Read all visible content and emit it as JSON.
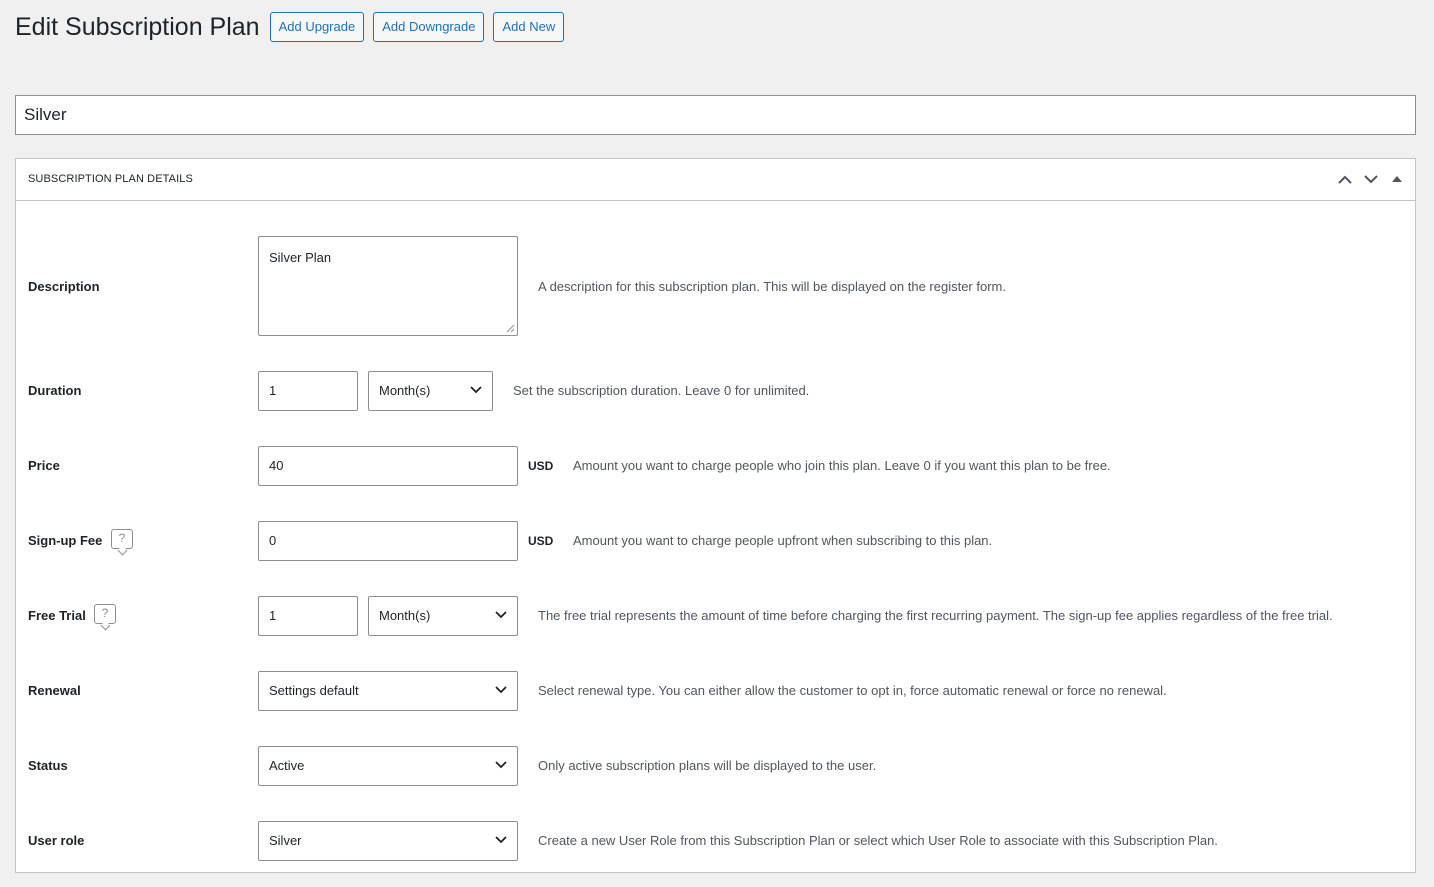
{
  "header": {
    "title": "Edit Subscription Plan",
    "buttons": [
      "Add Upgrade",
      "Add Downgrade",
      "Add New"
    ]
  },
  "plan_title": "Silver",
  "panel": {
    "title": "SUBSCRIPTION PLAN DETAILS",
    "controls": [
      "chevron-up-icon",
      "chevron-down-icon",
      "triangle-up-icon"
    ]
  },
  "fields": {
    "description": {
      "label": "Description",
      "value": "Silver Plan",
      "help": "A description for this subscription plan. This will be displayed on the register form."
    },
    "duration": {
      "label": "Duration",
      "value": "1",
      "unit": "Month(s)",
      "help": "Set the subscription duration. Leave 0 for unlimited."
    },
    "price": {
      "label": "Price",
      "value": "40",
      "currency": "USD",
      "help": "Amount you want to charge people who join this plan. Leave 0 if you want this plan to be free."
    },
    "signup_fee": {
      "label": "Sign-up Fee",
      "tooltip_icon": "?",
      "value": "0",
      "currency": "USD",
      "help": "Amount you want to charge people upfront when subscribing to this plan."
    },
    "free_trial": {
      "label": "Free Trial",
      "tooltip_icon": "?",
      "value": "1",
      "unit": "Month(s)",
      "help": "The free trial represents the amount of time before charging the first recurring payment. The sign-up fee applies regardless of the free trial."
    },
    "renewal": {
      "label": "Renewal",
      "value": "Settings default",
      "help": "Select renewal type. You can either allow the customer to opt in, force automatic renewal or force no renewal."
    },
    "status": {
      "label": "Status",
      "value": "Active",
      "help": "Only active subscription plans will be displayed to the user."
    },
    "user_role": {
      "label": "User role",
      "value": "Silver",
      "help": "Create a new User Role from this Subscription Plan or select which User Role to associate with this Subscription Plan."
    }
  },
  "colors": {
    "background": "#f0f0f1",
    "accent": "#2271b1",
    "text": "#1d2327",
    "muted": "#50575e",
    "border": "#8c8f94"
  }
}
